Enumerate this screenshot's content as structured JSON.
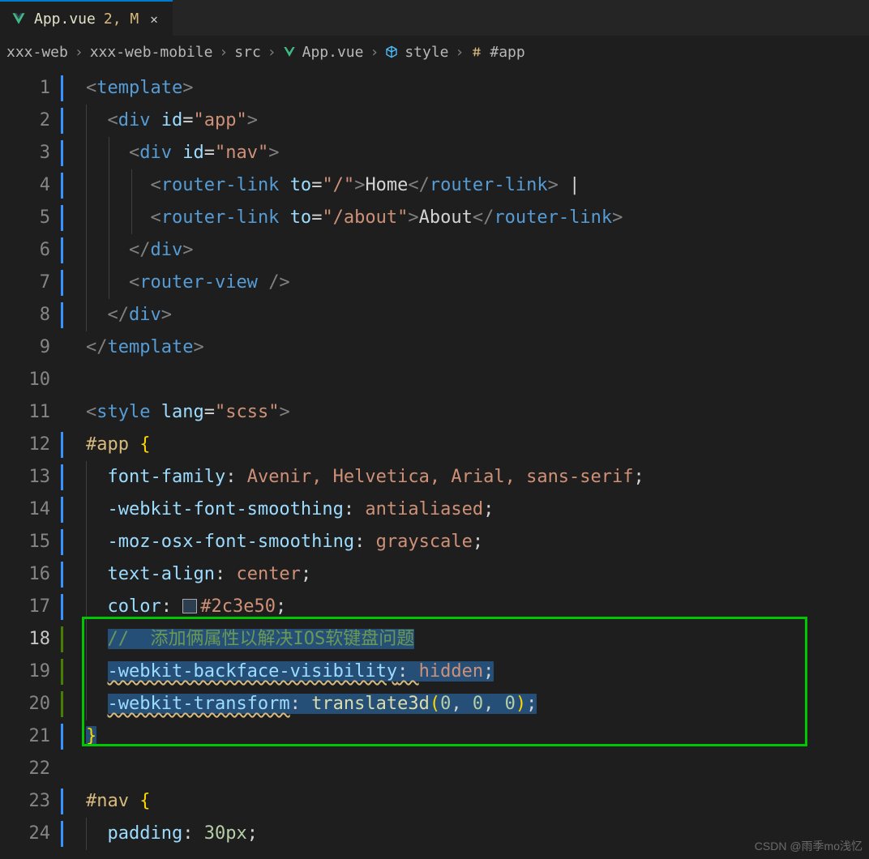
{
  "tab": {
    "filename": "App.vue",
    "modified_marker": "2, M",
    "close_label": "✕"
  },
  "breadcrumb": {
    "segments": [
      "xxx-web",
      "xxx-web-mobile",
      "src",
      "App.vue",
      "style",
      "#app"
    ]
  },
  "gutter": {
    "numbers": [
      "1",
      "2",
      "3",
      "4",
      "5",
      "6",
      "7",
      "8",
      "9",
      "10",
      "11",
      "12",
      "13",
      "14",
      "15",
      "16",
      "17",
      "18",
      "19",
      "20",
      "21",
      "22",
      "23",
      "24"
    ],
    "active_line": "18"
  },
  "code": {
    "l1": {
      "tag": "template"
    },
    "l2": {
      "tag": "div",
      "attr": "id",
      "val": "\"app\""
    },
    "l3": {
      "tag": "div",
      "attr": "id",
      "val": "\"nav\""
    },
    "l4": {
      "tag": "router-link",
      "attr": "to",
      "val": "\"/\"",
      "text": "Home",
      "sep": " |"
    },
    "l5": {
      "tag": "router-link",
      "attr": "to",
      "val": "\"/about\"",
      "text": "About"
    },
    "l6": {
      "tag": "div"
    },
    "l7": {
      "tag": "router-view"
    },
    "l8": {
      "tag": "div"
    },
    "l9": {
      "tag": "template"
    },
    "l11": {
      "tag": "style",
      "attr": "lang",
      "val": "\"scss\""
    },
    "l12": {
      "sel": "#app",
      "open": "{"
    },
    "l13": {
      "prop": "font-family",
      "val": "Avenir, Helvetica, Arial, sans-serif"
    },
    "l14": {
      "prop": "-webkit-font-smoothing",
      "val": "antialiased"
    },
    "l15": {
      "prop": "-moz-osx-font-smoothing",
      "val": "grayscale"
    },
    "l16": {
      "prop": "text-align",
      "val": "center"
    },
    "l17": {
      "prop": "color",
      "val": "#2c3e50"
    },
    "l18": {
      "comment": "//  添加俩属性以解决IOS软键盘问题"
    },
    "l19": {
      "prop": "-webkit-backface-visibility",
      "val": "hidden"
    },
    "l20": {
      "prop": "-webkit-transform",
      "fn": "translate3d",
      "args": [
        "0",
        "0",
        "0"
      ]
    },
    "l21": {
      "close": "}"
    },
    "l23": {
      "sel": "#nav",
      "open": "{"
    },
    "l24": {
      "prop": "padding",
      "val": "30px"
    }
  },
  "colors": {
    "swatch17": "#2c3e50"
  },
  "watermark": "CSDN @雨季mo浅忆"
}
